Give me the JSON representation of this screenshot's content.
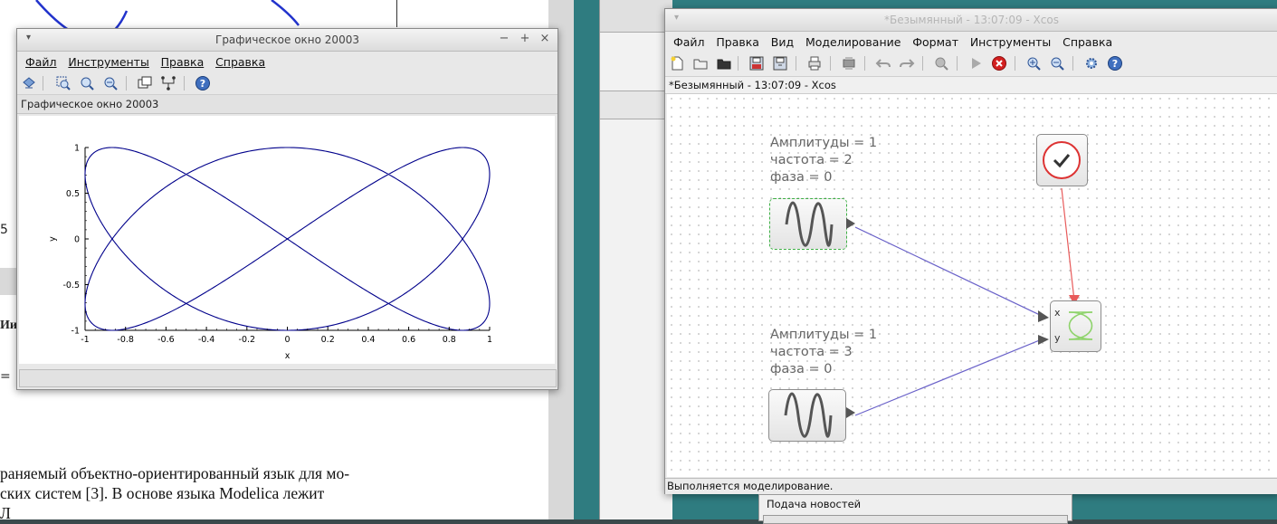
{
  "background_doc": {
    "text_lines": [
      "раняемый объектно-ориентированный язык для мо-",
      "ских систем [3]. В основе языка Modelica лежит",
      "Л"
    ],
    "fragment_5": "5",
    "fragment_bold": "Ии",
    "fragment_eq": "="
  },
  "graphic_window": {
    "title": "Графическое окно 20003",
    "menu": [
      "Файл",
      "Инструменты",
      "Правка",
      "Справка"
    ],
    "tab_label": "Графическое окно 20003",
    "toolbar_icons": [
      "rotate-icon",
      "zoom-area-icon",
      "zoom-in-icon",
      "zoom-out-icon",
      "windows-icon",
      "datatip-icon",
      "help-icon"
    ],
    "window_buttons": [
      "▾",
      "−",
      "+",
      "×"
    ]
  },
  "chart_data": {
    "type": "line",
    "title": "",
    "xlabel": "x",
    "ylabel": "y",
    "xlim": [
      -1,
      1
    ],
    "ylim": [
      -1,
      1
    ],
    "x_ticks": [
      "-1",
      "-0.8",
      "-0.6",
      "-0.4",
      "-0.2",
      "0",
      "0.2",
      "0.4",
      "0.6",
      "0.8",
      "1"
    ],
    "y_ticks": [
      "1",
      "0.5",
      "0",
      "-0.5",
      "-1"
    ],
    "series": [
      {
        "x_expr": "sin(2t)",
        "y_expr": "sin(3t)",
        "color": "#00008b"
      }
    ],
    "grid": false
  },
  "xcos_window": {
    "title": "*Безымянный - 13:07:09 - Xcos",
    "subtitle": "*Безымянный - 13:07:09 - Xcos",
    "menu": [
      "Файл",
      "Правка",
      "Вид",
      "Моделирование",
      "Формат",
      "Инструменты",
      "Справка"
    ],
    "toolbar_icons": [
      "new-icon",
      "open-icon",
      "open-in-icon",
      "save-icon",
      "save-as-icon",
      "print-icon",
      "export-icon",
      "undo-icon",
      "redo-icon",
      "zoom-fit-icon",
      "start-icon",
      "stop-icon",
      "zoom-in-icon",
      "zoom-out-icon",
      "settings-icon",
      "help-icon"
    ],
    "status": "Выполняется моделирование.",
    "block1_params": [
      "Амплитуды = 1",
      "частота = 2",
      "фаза = 0"
    ],
    "block2_params": [
      "Амплитуды = 1",
      "частота = 3",
      "фаза = 0"
    ],
    "scope_port_x": "x",
    "scope_port_y": "y",
    "link_color": "#6a62c9",
    "event_link_color": "#e85b5b"
  },
  "news_panel": {
    "title": "Подача новостей"
  }
}
